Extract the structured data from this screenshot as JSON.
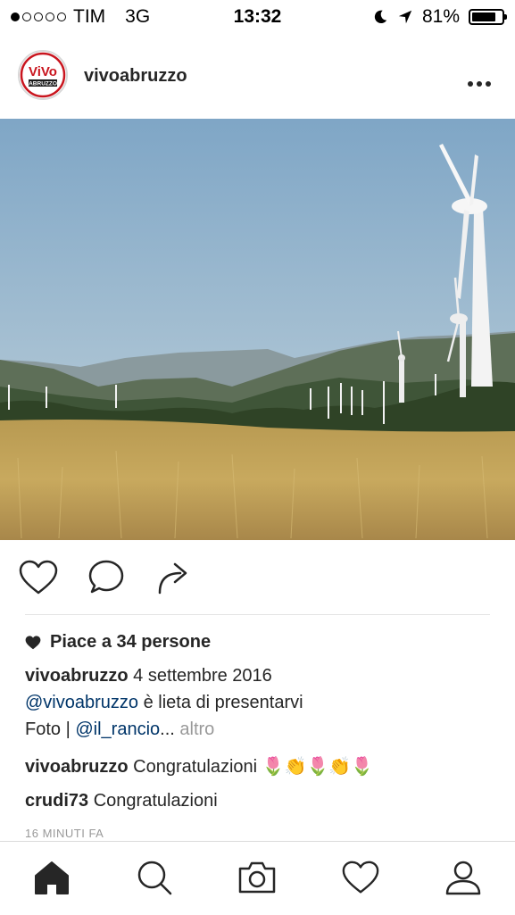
{
  "status_bar": {
    "carrier": "TIM",
    "network": "3G",
    "time": "13:32",
    "battery": "81%",
    "battery_level": 0.81,
    "signal_bars_filled": 1,
    "signal_bars_total": 5
  },
  "post": {
    "username": "vivoabruzzo",
    "avatar_text": "ViVo ABRUZZO",
    "more_icon": "more-horizontal-icon",
    "likes_text": "Piace a 34 persone",
    "caption": {
      "username": "vivoabruzzo",
      "date": "4 settembre 2016",
      "mention1": "@vivoabruzzo",
      "text1": "è lieta di presentarvi",
      "text2": "Foto |",
      "mention2": "@il_rancio",
      "ellipsis": "...",
      "more": "altro"
    },
    "comments": [
      {
        "username": "vivoabruzzo",
        "text": "Congratulazioni 🌷👏🌷👏🌷"
      },
      {
        "username": "crudi73",
        "text": "Congratulazioni"
      }
    ],
    "time_ago": "16 MINUTI FA"
  },
  "tab_bar": {
    "icons": [
      "home-icon",
      "search-icon",
      "camera-icon",
      "heart-icon",
      "profile-icon"
    ]
  },
  "colors": {
    "link": "#003569",
    "text": "#262626",
    "muted": "#999999"
  }
}
